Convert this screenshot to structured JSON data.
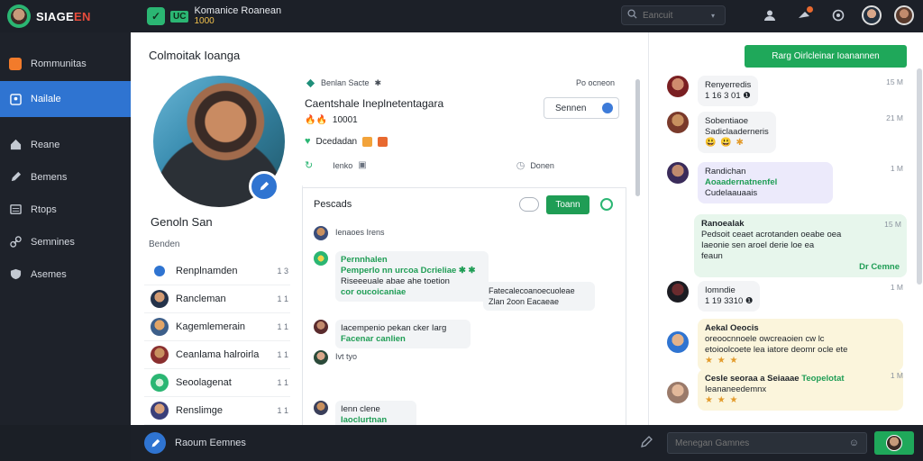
{
  "brand": {
    "name_main": "SIAGE",
    "name_accent": "EN",
    "accent_color": "#e74c3c"
  },
  "app": {
    "code_line1": "UC",
    "code_line2": "RS",
    "title": "Komanice Roanean",
    "subtitle": "1000"
  },
  "search": {
    "placeholder": "Eancuit"
  },
  "sidebar": {
    "items": [
      {
        "label": "Rommunitas",
        "icon": "community-icon"
      },
      {
        "label": "Nailale",
        "icon": "users-icon"
      },
      {
        "label": "Reane",
        "icon": "home-icon"
      },
      {
        "label": "Bemens",
        "icon": "pencil-icon"
      },
      {
        "label": "Rtops",
        "icon": "list-icon"
      },
      {
        "label": "Semnines",
        "icon": "link-icon"
      },
      {
        "label": "Asemes",
        "icon": "shield-icon"
      }
    ]
  },
  "main": {
    "title": "Colmoitak Ioanga",
    "profile_name": "Genoln San",
    "section_label": "Benden",
    "friends": [
      {
        "name": "Renplnamden",
        "count": "1 3"
      },
      {
        "name": "Rancleman",
        "count": "1 1"
      },
      {
        "name": "Kagemlemerain",
        "count": "1 1"
      },
      {
        "name": "Ceanlama halroirla",
        "count": "1 1"
      },
      {
        "name": "Seoolagenat",
        "count": "1 1"
      },
      {
        "name": "Renslimge",
        "count": "1 1"
      }
    ],
    "info": {
      "top_label": "Benlan Sacte",
      "top_suffix": "✱",
      "pro_label": "Po ocneon",
      "status": "Caentshale Ineplnetentagara",
      "number": "10001",
      "badge_label": "Dcedadan",
      "stat_left": "Ienko",
      "stat_right": "Donen",
      "search_button": "Sennen"
    },
    "posts": {
      "heading": "Pescads",
      "button": "Toann",
      "items": [
        {
          "author": "Ienaoes Irens",
          "lines": []
        },
        {
          "author": "Pernnhalen",
          "lines": [
            "Pemperlo nn urcoa Dcrieliae ✱ ✱",
            "Riseeeuale abae ahe toetion",
            "cor oucoicaniae"
          ],
          "highlight_first": true
        },
        {
          "author": "Iacempenio pekan cker Iarg",
          "lines": [
            "Facenar canlien"
          ]
        },
        {
          "author": "Ivt tyo",
          "lines": []
        },
        {
          "author": "Ienn clene",
          "lines": [
            "Iaoclurtnan"
          ]
        }
      ],
      "side_note": {
        "line1": "Fatecalecoanoecuoleae",
        "line2": "Zlan 2oon  Eacaeae"
      }
    }
  },
  "right": {
    "top_button": "Rarg Oirlcleinar Ioanannen",
    "messages": [
      {
        "name": "Renyerredis",
        "body": "1 16   3 01 ❶",
        "time": "15 M",
        "style": "grey"
      },
      {
        "name": "Sobentiaoe",
        "body": "Sadiclaaderneris",
        "time": "21 M",
        "style": "grey",
        "emoji": "😃 😃 ✱"
      },
      {
        "name": "Randichan",
        "body": "Aoaadernatnenfel",
        "body2": "Cudelaauaais",
        "time": "1 M",
        "style": "lav",
        "inline_time": "1.1 M"
      },
      {
        "name": "Ranoealak",
        "body": "Pedsoit ceaet acrotanden oeabe oea",
        "body2": "Iaeonie sen aroel derie loe ea",
        "body3": "feaun",
        "time": "15 M",
        "style": "green",
        "footer": "Dr Cemne"
      },
      {
        "name": "Iomndie",
        "body": "1 19   3310 ❶",
        "time": "1 M",
        "style": "grey"
      },
      {
        "name": "Aekal Oeocis",
        "body": "oreoocnnoele owcreaoien cw lc",
        "body2": "etoioolcoete lea iatore deomr ocle ete",
        "time": "",
        "style": "yellow",
        "stars": "★ ★ ★"
      },
      {
        "name": "Cesle seoraa a Seiaaae",
        "body": "Teopelotat",
        "body2": "Ieananeedemnx",
        "time": "1 M",
        "style": "yellow",
        "stars": "★ ★ ★"
      }
    ]
  },
  "bottom": {
    "label": "Raoum Eemnes",
    "input_placeholder": "Menegan Gamnes"
  }
}
